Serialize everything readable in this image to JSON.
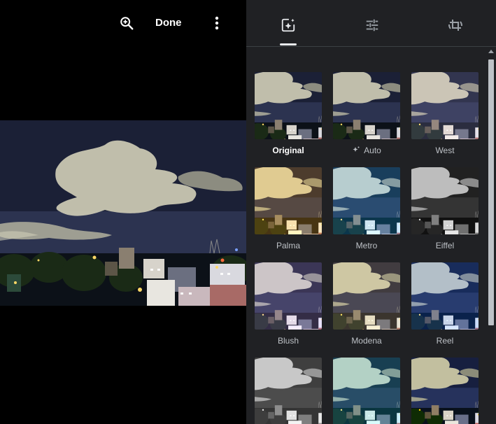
{
  "toolbar": {
    "done_label": "Done",
    "zoom_icon": "zoom-in-icon",
    "more_icon": "more-vert-icon"
  },
  "tabs": [
    {
      "name": "filters",
      "icon": "photo-filter-icon",
      "active": true
    },
    {
      "name": "adjust",
      "icon": "tune-icon",
      "active": false
    },
    {
      "name": "crop",
      "icon": "crop-rotate-icon",
      "active": false
    }
  ],
  "filters": [
    {
      "label": "Original",
      "selected": true,
      "tint": ""
    },
    {
      "label": "Auto",
      "selected": false,
      "icon": "auto-sparkle-icon",
      "tint": ""
    },
    {
      "label": "West",
      "selected": false,
      "tint": "west"
    },
    {
      "label": "Palma",
      "selected": false,
      "tint": "palma"
    },
    {
      "label": "Metro",
      "selected": false,
      "tint": "metro"
    },
    {
      "label": "Eiffel",
      "selected": false,
      "tint": "eiffel"
    },
    {
      "label": "Blush",
      "selected": false,
      "tint": "blush"
    },
    {
      "label": "Modena",
      "selected": false,
      "tint": "modena"
    },
    {
      "label": "Reel",
      "selected": false,
      "tint": "reel"
    },
    {
      "label": "",
      "selected": false,
      "tint": "bw"
    },
    {
      "label": "",
      "selected": false,
      "tint": "teal"
    },
    {
      "label": "",
      "selected": false,
      "tint": "vivid"
    }
  ],
  "colors": {
    "panel_bg": "#202124",
    "text_primary": "#ffffff",
    "text_secondary": "#bdc1c6"
  }
}
